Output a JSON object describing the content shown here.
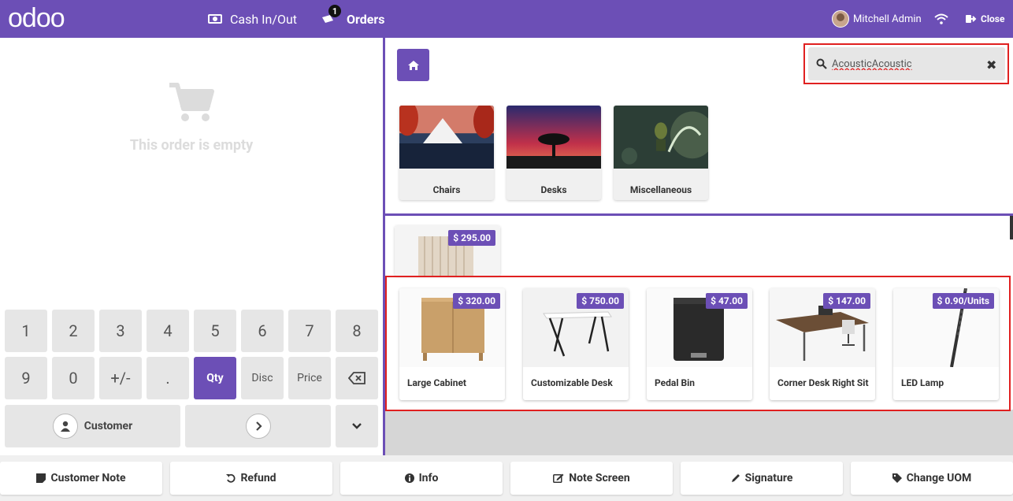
{
  "header": {
    "logo": "odoo",
    "cash_label": "Cash In/Out",
    "orders_label": "Orders",
    "orders_count": "1",
    "user_name": "Mitchell Admin",
    "close_label": "Close"
  },
  "order": {
    "empty_text": "This order is empty"
  },
  "numpad": {
    "keys": [
      "1",
      "2",
      "3",
      "4",
      "5",
      "6",
      "7",
      "8",
      "9",
      "0",
      "+/-",
      ".",
      "Qty",
      "Disc",
      "Price"
    ],
    "customer_label": "Customer"
  },
  "search": {
    "value": "AcousticAcoustic"
  },
  "categories": [
    {
      "label": "Chairs"
    },
    {
      "label": "Desks"
    },
    {
      "label": "Miscellaneous"
    }
  ],
  "partial_product": {
    "price": "$ 295.00"
  },
  "products": [
    {
      "name": "Large Cabinet",
      "price": "$ 320.00"
    },
    {
      "name": "Customizable Desk",
      "price": "$ 750.00"
    },
    {
      "name": "Pedal Bin",
      "price": "$ 47.00"
    },
    {
      "name": "Corner Desk Right Sit",
      "price": "$ 147.00"
    },
    {
      "name": "LED Lamp",
      "price": "$ 0.90/Units"
    }
  ],
  "actions": [
    {
      "label": "Customer Note"
    },
    {
      "label": "Refund"
    },
    {
      "label": "Info"
    },
    {
      "label": "Note Screen"
    },
    {
      "label": "Signature"
    },
    {
      "label": "Change UOM"
    }
  ],
  "colors": {
    "accent": "#6c4fb6",
    "highlight": "#e02020"
  }
}
